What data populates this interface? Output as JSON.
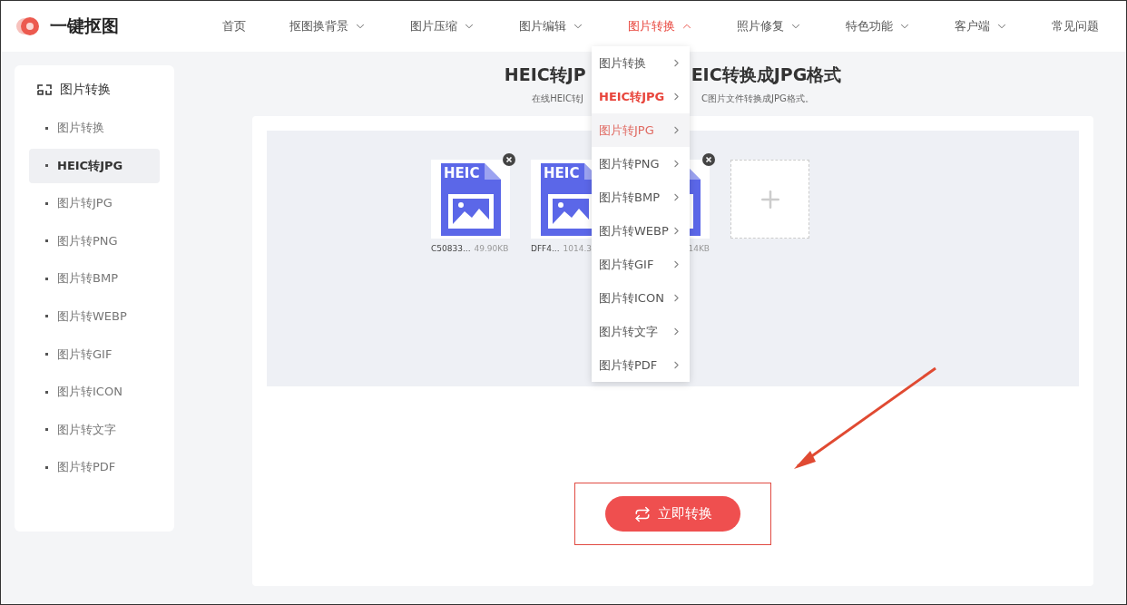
{
  "logo": {
    "text": "一键抠图"
  },
  "nav": [
    {
      "label": "首页",
      "dropdown": false,
      "selected": false
    },
    {
      "label": "抠图换背景",
      "dropdown": true,
      "selected": false
    },
    {
      "label": "图片压缩",
      "dropdown": true,
      "selected": false
    },
    {
      "label": "图片编辑",
      "dropdown": true,
      "selected": false
    },
    {
      "label": "图片转换",
      "dropdown": true,
      "selected": true
    },
    {
      "label": "照片修复",
      "dropdown": true,
      "selected": false
    },
    {
      "label": "特色功能",
      "dropdown": true,
      "selected": false
    },
    {
      "label": "客户端",
      "dropdown": true,
      "selected": false
    },
    {
      "label": "常见问题",
      "dropdown": false,
      "selected": false
    }
  ],
  "dropdown": [
    {
      "label": "图片转换",
      "selected": false,
      "hovered": false
    },
    {
      "label": "HEIC转JPG",
      "selected": true,
      "hovered": false
    },
    {
      "label": "图片转JPG",
      "selected": false,
      "hovered": true
    },
    {
      "label": "图片转PNG",
      "selected": false,
      "hovered": false
    },
    {
      "label": "图片转BMP",
      "selected": false,
      "hovered": false
    },
    {
      "label": "图片转WEBP",
      "selected": false,
      "hovered": false
    },
    {
      "label": "图片转GIF",
      "selected": false,
      "hovered": false
    },
    {
      "label": "图片转ICON",
      "selected": false,
      "hovered": false
    },
    {
      "label": "图片转文字",
      "selected": false,
      "hovered": false
    },
    {
      "label": "图片转PDF",
      "selected": false,
      "hovered": false
    }
  ],
  "sidebar": {
    "title": "图片转换",
    "items": [
      {
        "label": "图片转换",
        "selected": false
      },
      {
        "label": "HEIC转JPG",
        "selected": true
      },
      {
        "label": "图片转JPG",
        "selected": false
      },
      {
        "label": "图片转PNG",
        "selected": false
      },
      {
        "label": "图片转BMP",
        "selected": false
      },
      {
        "label": "图片转WEBP",
        "selected": false
      },
      {
        "label": "图片转GIF",
        "selected": false
      },
      {
        "label": "图片转ICON",
        "selected": false
      },
      {
        "label": "图片转文字",
        "selected": false
      },
      {
        "label": "图片转PDF",
        "selected": false
      }
    ]
  },
  "heading": {
    "title_left": "HEIC转JP",
    "title_right": "EIC转换成JPG格式",
    "subtitle_left": "在线HEIC转J",
    "subtitle_right": "C图片文件转换成JPG格式。"
  },
  "files": [
    {
      "badge": "HEIC",
      "name": "C50833...",
      "size": "49.90KB"
    },
    {
      "badge": "HEIC",
      "name": "DFF4...",
      "size": "1014.3"
    },
    {
      "size": "14KB"
    }
  ],
  "convert_button": {
    "label": "立即转换"
  }
}
